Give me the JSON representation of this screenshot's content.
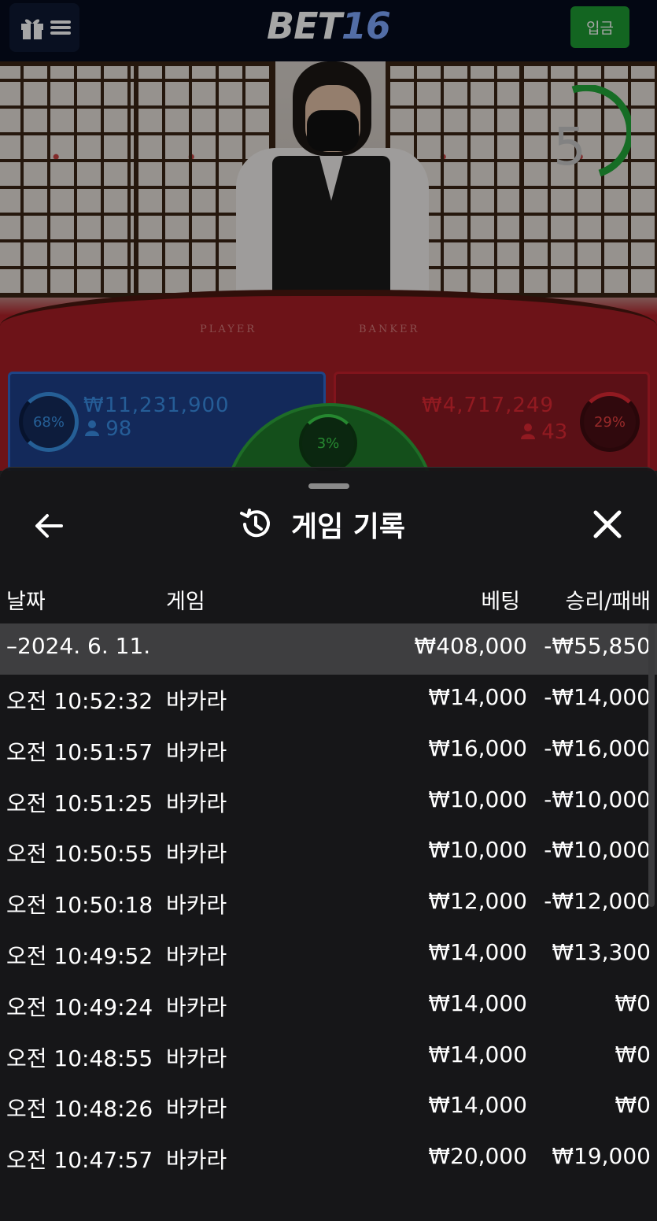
{
  "header": {
    "logo_main": "BET",
    "logo_accent": "16",
    "deposit_label": "입금"
  },
  "live_table": {
    "countdown": "5",
    "felt_player_label": "PLAYER",
    "felt_banker_label": "BANKER",
    "player": {
      "percent": "68%",
      "amount": "₩11,231,900",
      "bettors": "98",
      "color": "#3a8fe8"
    },
    "banker": {
      "percent": "29%",
      "amount": "₩4,717,249",
      "bettors": "43",
      "color": "#e02834"
    },
    "tie": {
      "percent": "3%",
      "color": "#3bd14a"
    }
  },
  "history": {
    "title": "게임 기록",
    "columns": {
      "date": "날짜",
      "game": "게임",
      "bet": "베팅",
      "result": "승리/패배"
    },
    "summary": {
      "date": "–2024. 6. 11.",
      "bet": "₩408,000",
      "result": "-₩55,850"
    },
    "rows": [
      {
        "time": "오전 10:52:32",
        "game": "바카라",
        "bet": "₩14,000",
        "result": "-₩14,000"
      },
      {
        "time": "오전 10:51:57",
        "game": "바카라",
        "bet": "₩16,000",
        "result": "-₩16,000"
      },
      {
        "time": "오전 10:51:25",
        "game": "바카라",
        "bet": "₩10,000",
        "result": "-₩10,000"
      },
      {
        "time": "오전 10:50:55",
        "game": "바카라",
        "bet": "₩10,000",
        "result": "-₩10,000"
      },
      {
        "time": "오전 10:50:18",
        "game": "바카라",
        "bet": "₩12,000",
        "result": "-₩12,000"
      },
      {
        "time": "오전 10:49:52",
        "game": "바카라",
        "bet": "₩14,000",
        "result": "₩13,300"
      },
      {
        "time": "오전 10:49:24",
        "game": "바카라",
        "bet": "₩14,000",
        "result": "₩0"
      },
      {
        "time": "오전 10:48:55",
        "game": "바카라",
        "bet": "₩14,000",
        "result": "₩0"
      },
      {
        "time": "오전 10:48:26",
        "game": "바카라",
        "bet": "₩14,000",
        "result": "₩0"
      },
      {
        "time": "오전 10:47:57",
        "game": "바카라",
        "bet": "₩20,000",
        "result": "₩19,000"
      }
    ]
  },
  "icons": {
    "menu": "gift-menu-icon",
    "back": "arrow-left-icon",
    "history": "history-icon",
    "close": "close-icon",
    "user": "user-icon"
  }
}
